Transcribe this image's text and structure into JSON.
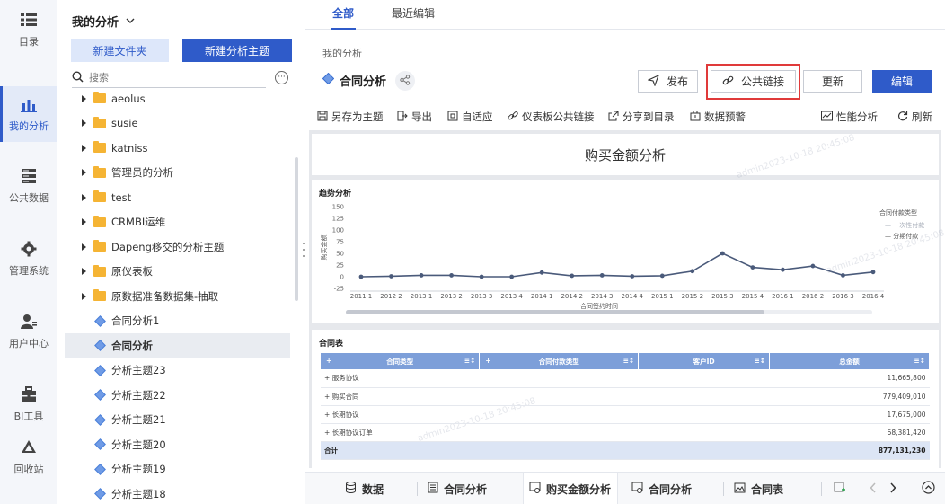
{
  "nav": {
    "items": [
      {
        "label": "目录",
        "icon": "list-icon"
      },
      {
        "label": "我的分析",
        "icon": "bar-chart-icon"
      },
      {
        "label": "公共数据",
        "icon": "database-icon"
      },
      {
        "label": "管理系统",
        "icon": "gear-icon"
      },
      {
        "label": "用户中心",
        "icon": "user-icon"
      },
      {
        "label": "BI工具",
        "icon": "toolbox-icon"
      },
      {
        "label": "回收站",
        "icon": "recycle-icon"
      }
    ]
  },
  "tree": {
    "title": "我的分析",
    "new_folder": "新建文件夹",
    "new_subject": "新建分析主题",
    "search_placeholder": "搜索",
    "more": "···",
    "items": [
      {
        "label": "aeolus",
        "type": "folder"
      },
      {
        "label": "susie",
        "type": "folder"
      },
      {
        "label": "katniss",
        "type": "folder"
      },
      {
        "label": "管理员的分析",
        "type": "folder"
      },
      {
        "label": "test",
        "type": "folder"
      },
      {
        "label": "CRMBI运维",
        "type": "folder"
      },
      {
        "label": "Dapeng移交的分析主题",
        "type": "folder"
      },
      {
        "label": "原仪表板",
        "type": "folder"
      },
      {
        "label": "原数据准备数据集-抽取",
        "type": "folder"
      },
      {
        "label": "合同分析1",
        "type": "subject"
      },
      {
        "label": "合同分析",
        "type": "subject",
        "selected": true
      },
      {
        "label": "分析主题23",
        "type": "subject"
      },
      {
        "label": "分析主题22",
        "type": "subject"
      },
      {
        "label": "分析主题21",
        "type": "subject"
      },
      {
        "label": "分析主题20",
        "type": "subject"
      },
      {
        "label": "分析主题19",
        "type": "subject"
      },
      {
        "label": "分析主题18",
        "type": "subject"
      }
    ]
  },
  "tabs": [
    "全部",
    "最近编辑"
  ],
  "breadcrumb": "我的分析",
  "report_title": "合同分析",
  "actions": {
    "publish": "发布",
    "public_link": "公共链接",
    "update": "更新",
    "edit": "编辑"
  },
  "toolbar": {
    "save_as": "另存为主题",
    "export": "导出",
    "adapt": "自适应",
    "dashboard_link": "仪表板公共链接",
    "share": "分享到目录",
    "alert": "数据预警",
    "performance": "性能分析",
    "refresh": "刷新"
  },
  "dashboard": {
    "title": "购买金额分析",
    "watermark": "admin2023-10-18 20:45:08",
    "trend": {
      "title": "趋势分析"
    },
    "table": {
      "title": "合同表",
      "headers": [
        "合同类型",
        "合同付款类型",
        "客户ID",
        "总金额"
      ],
      "rows": [
        {
          "type": "服务协议",
          "amount": "11,665,800"
        },
        {
          "type": "购买合同",
          "amount": "779,409,010"
        },
        {
          "type": "长期协议",
          "amount": "17,675,000"
        },
        {
          "type": "长期协议订单",
          "amount": "68,381,420"
        }
      ],
      "total_label": "合计",
      "total_amount": "877,131,230"
    }
  },
  "chart_data": {
    "type": "line",
    "title": "趋势分析",
    "xlabel": "合同签约时间",
    "ylabel": "购买金额",
    "categories": [
      "2011 1",
      "2012 2",
      "2013 1",
      "2013 2",
      "2013 3",
      "2013 4",
      "2014 1",
      "2014 2",
      "2014 3",
      "2014 4",
      "2015 1",
      "2015 2",
      "2015 3",
      "2015 4",
      "2016 1",
      "2016 2",
      "2016 3",
      "2016 4"
    ],
    "yticks": [
      -25,
      0,
      25,
      50,
      75,
      100,
      125,
      150
    ],
    "ylim": [
      -25,
      150
    ],
    "legend_title": "合同付款类型",
    "series": [
      {
        "name": "一次性付款",
        "color": "#c5cad4",
        "values": []
      },
      {
        "name": "分期付款",
        "color": "#4a5a7a",
        "values": [
          0,
          1,
          3,
          3,
          0,
          0,
          9,
          2,
          3,
          1,
          2,
          12,
          50,
          20,
          15,
          23,
          3,
          10
        ]
      }
    ],
    "legend_position": "right",
    "grid": false
  },
  "bottom_tabs": [
    {
      "label": "数据",
      "icon": "database-icon"
    },
    {
      "label": "合同分析",
      "icon": "document-icon"
    },
    {
      "label": "购买金额分析",
      "icon": "dashboard-icon",
      "active": true
    },
    {
      "label": "合同分析",
      "icon": "dashboard-icon"
    },
    {
      "label": "合同表",
      "icon": "image-icon"
    }
  ]
}
